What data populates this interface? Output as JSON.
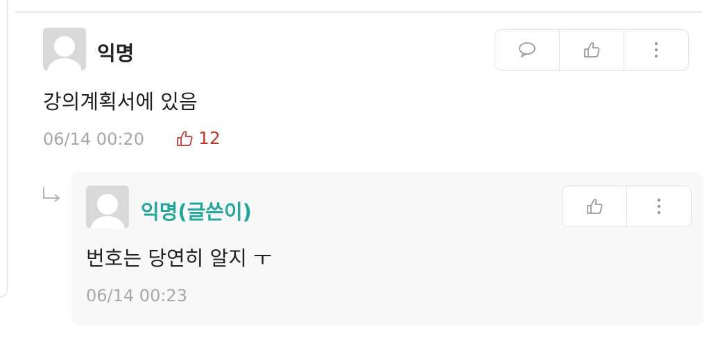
{
  "comment": {
    "author": "익명",
    "text": "강의계획서에 있음",
    "timestamp": "06/14 00:20",
    "like_count": "12"
  },
  "reply": {
    "author": "익명(글쓴이)",
    "text": "번호는 당연히 알지 ㅜ",
    "timestamp": "06/14 00:23"
  },
  "colors": {
    "op_author": "#22a79a",
    "like_accent": "#c1392b",
    "meta_gray": "#a7a7a7",
    "reply_bg": "#f8f8f8"
  },
  "icons": {
    "comment_reply": "speech-bubble-icon",
    "like": "thumbs-up-icon",
    "more": "vertical-dots-icon",
    "reply_indicator": "reply-arrow-icon"
  }
}
